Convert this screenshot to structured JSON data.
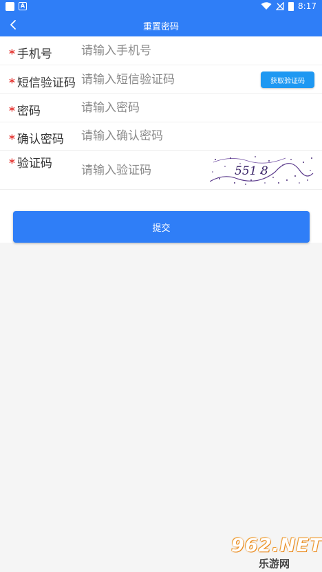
{
  "status_bar": {
    "time": "8:17"
  },
  "header": {
    "title": "重置密码"
  },
  "form": {
    "phone": {
      "label": "手机号",
      "placeholder": "请输入手机号"
    },
    "sms_code": {
      "label": "短信验证码",
      "placeholder": "请输入短信验证码",
      "button": "获取验证码"
    },
    "password": {
      "label": "密码",
      "placeholder": "请输入密码"
    },
    "confirm_password": {
      "label": "确认密码",
      "placeholder": "请输入确认密码"
    },
    "captcha": {
      "label": "验证码",
      "placeholder": "请输入验证码",
      "image_text": "551 8"
    }
  },
  "submit": {
    "label": "提交"
  },
  "required_mark": "*",
  "watermark": {
    "main": "962.NET",
    "sub": "乐游网"
  },
  "colors": {
    "primary": "#2f7ef7",
    "sms_button": "#1e98f2",
    "required": "#e53935",
    "background": "#f5f5f5"
  },
  "icons": [
    "back-chevron-icon",
    "wifi-icon",
    "signal-icon",
    "battery-icon"
  ]
}
